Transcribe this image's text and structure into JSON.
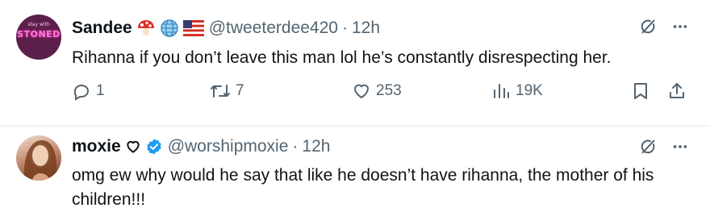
{
  "tweets": [
    {
      "name": "Sandee",
      "handle": "@tweeterdee420",
      "time": "12h",
      "avatar_text": "STONED",
      "avatar_text_small": "stay with",
      "text": "Rihanna if you don’t leave this man lol he’s constantly disrespecting her.",
      "badges": [
        "mushroom-emoji",
        "globe-emoji",
        "us-flag-emoji"
      ],
      "actions": {
        "replies": "1",
        "reposts": "7",
        "likes": "253",
        "views": "19K"
      }
    },
    {
      "name": "moxie",
      "handle": "@worshipmoxie",
      "time": "12h",
      "badges": [
        "heart-outline-emoji",
        "verified-badge"
      ],
      "text": "omg ew why would he say that like he doesn’t have rihanna, the mother of his children!!!"
    }
  ],
  "colors": {
    "text": "#0f1419",
    "secondary": "#536471",
    "verified": "#1d9bf0",
    "divider": "#eff3f4"
  }
}
